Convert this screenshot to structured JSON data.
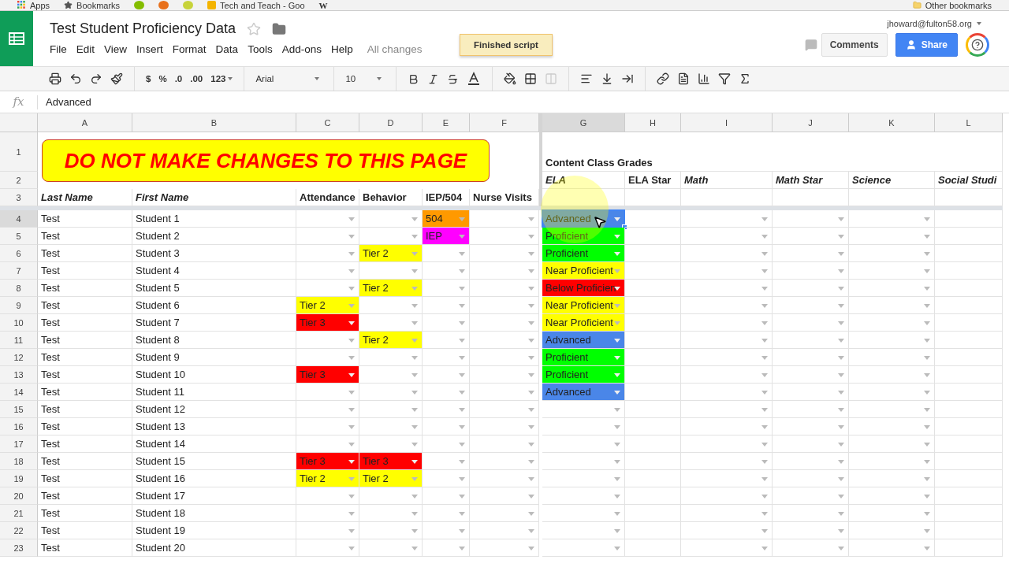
{
  "bookmarks_bar": {
    "items": [
      {
        "kind": "apps",
        "label": "Apps"
      },
      {
        "kind": "star",
        "label": "Bookmarks"
      },
      {
        "kind": "round",
        "color": "#84bd00"
      },
      {
        "kind": "round",
        "color": "#e8711c"
      },
      {
        "kind": "round",
        "color": "#c7d33a"
      },
      {
        "kind": "page",
        "label": "Tech and Teach - Goo"
      },
      {
        "kind": "text_icon",
        "label": "W"
      }
    ],
    "other": "Other bookmarks"
  },
  "document": {
    "title": "Test Student Proficiency Data",
    "starred": false,
    "menu": [
      "File",
      "Edit",
      "View",
      "Insert",
      "Format",
      "Data",
      "Tools",
      "Add-ons",
      "Help"
    ],
    "save_status": "All changes",
    "account": "jhoward@fulton58.org",
    "comments_button": "Comments",
    "share_button": "Share"
  },
  "toast": "Finished script",
  "toolbar": {
    "currency": "$",
    "percent": "%",
    "decimals_less": ".0",
    "decimals_more": ".00",
    "number_formats": "123",
    "font": "Arial",
    "font_size": "10"
  },
  "formula_bar": {
    "label": "fx",
    "value": "Advanced"
  },
  "banner": "DO NOT MAKE CHANGES TO THIS PAGE",
  "columns": [
    {
      "letter": "A",
      "dropdown": false,
      "selected": false
    },
    {
      "letter": "B",
      "dropdown": false,
      "selected": false
    },
    {
      "letter": "C",
      "dropdown": true,
      "selected": false
    },
    {
      "letter": "D",
      "dropdown": true,
      "selected": false
    },
    {
      "letter": "E",
      "dropdown": true,
      "selected": false
    },
    {
      "letter": "F",
      "dropdown": true,
      "selected": false
    },
    {
      "letter": "G",
      "dropdown": true,
      "selected": true
    },
    {
      "letter": "H",
      "dropdown": false,
      "selected": false
    },
    {
      "letter": "I",
      "dropdown": true,
      "selected": false
    },
    {
      "letter": "J",
      "dropdown": true,
      "selected": false
    },
    {
      "letter": "K",
      "dropdown": true,
      "selected": false
    },
    {
      "letter": "L",
      "dropdown": false,
      "selected": false
    }
  ],
  "header_rows": [
    {
      "number": "1",
      "cells": [
        null,
        null,
        null,
        null,
        null,
        null,
        {
          "text": "Content Class Grades",
          "italic": false
        },
        null,
        null,
        null,
        null,
        null
      ]
    },
    {
      "number": "2",
      "cells": [
        null,
        null,
        null,
        null,
        null,
        null,
        {
          "text": "ELA",
          "italic": true
        },
        {
          "text": "ELA Star",
          "italic": false
        },
        {
          "text": "Math",
          "italic": true
        },
        {
          "text": "Math Star",
          "italic": true
        },
        {
          "text": "Science",
          "italic": true
        },
        {
          "text": "Social Studi",
          "italic": true
        }
      ]
    },
    {
      "number": "3",
      "cells": [
        {
          "text": "Last Name",
          "italic": true
        },
        {
          "text": "First Name",
          "italic": true
        },
        {
          "text": "Attendance",
          "italic": false
        },
        {
          "text": "Behavior",
          "italic": false
        },
        {
          "text": "IEP/504",
          "italic": false
        },
        {
          "text": "Nurse Visits",
          "italic": false
        },
        null,
        null,
        null,
        null,
        null,
        null
      ]
    }
  ],
  "rows": [
    {
      "number": "4",
      "selected": true,
      "last_name": "Test",
      "first_name": "Student 1",
      "cells": [
        null,
        null,
        {
          "text": "504",
          "color": "#ff9900"
        },
        null,
        {
          "text": "Advanced",
          "color": "#4a86e8"
        },
        null,
        null,
        null,
        null,
        null
      ]
    },
    {
      "number": "5",
      "selected": false,
      "last_name": "Test",
      "first_name": "Student 2",
      "cells": [
        null,
        null,
        {
          "text": "IEP",
          "color": "#ff00ff"
        },
        null,
        {
          "text": "Proficient",
          "color": "#00ff00"
        },
        null,
        null,
        null,
        null,
        null
      ]
    },
    {
      "number": "6",
      "selected": false,
      "last_name": "Test",
      "first_name": "Student 3",
      "cells": [
        null,
        {
          "text": "Tier 2",
          "color": "#ffff00"
        },
        null,
        null,
        {
          "text": "Proficient",
          "color": "#00ff00"
        },
        null,
        null,
        null,
        null,
        null
      ]
    },
    {
      "number": "7",
      "selected": false,
      "last_name": "Test",
      "first_name": "Student 4",
      "cells": [
        null,
        null,
        null,
        null,
        {
          "text": "Near Proficient",
          "color": "#ffff00"
        },
        null,
        null,
        null,
        null,
        null
      ]
    },
    {
      "number": "8",
      "selected": false,
      "last_name": "Test",
      "first_name": "Student 5",
      "cells": [
        null,
        {
          "text": "Tier 2",
          "color": "#ffff00"
        },
        null,
        null,
        {
          "text": "Below Proficien",
          "color": "#ff0000"
        },
        null,
        null,
        null,
        null,
        null
      ]
    },
    {
      "number": "9",
      "selected": false,
      "last_name": "Test",
      "first_name": "Student 6",
      "cells": [
        {
          "text": "Tier 2",
          "color": "#ffff00"
        },
        null,
        null,
        null,
        {
          "text": "Near Proficient",
          "color": "#ffff00"
        },
        null,
        null,
        null,
        null,
        null
      ]
    },
    {
      "number": "10",
      "selected": false,
      "last_name": "Test",
      "first_name": "Student 7",
      "cells": [
        {
          "text": "Tier 3",
          "color": "#ff0000"
        },
        null,
        null,
        null,
        {
          "text": "Near Proficient",
          "color": "#ffff00"
        },
        null,
        null,
        null,
        null,
        null
      ]
    },
    {
      "number": "11",
      "selected": false,
      "last_name": "Test",
      "first_name": "Student 8",
      "cells": [
        null,
        {
          "text": "Tier 2",
          "color": "#ffff00"
        },
        null,
        null,
        {
          "text": "Advanced",
          "color": "#4a86e8"
        },
        null,
        null,
        null,
        null,
        null
      ]
    },
    {
      "number": "12",
      "selected": false,
      "last_name": "Test",
      "first_name": "Student 9",
      "cells": [
        null,
        null,
        null,
        null,
        {
          "text": "Proficient",
          "color": "#00ff00"
        },
        null,
        null,
        null,
        null,
        null
      ]
    },
    {
      "number": "13",
      "selected": false,
      "last_name": "Test",
      "first_name": "Student 10",
      "cells": [
        {
          "text": "Tier 3",
          "color": "#ff0000"
        },
        null,
        null,
        null,
        {
          "text": "Proficient",
          "color": "#00ff00"
        },
        null,
        null,
        null,
        null,
        null
      ]
    },
    {
      "number": "14",
      "selected": false,
      "last_name": "Test",
      "first_name": "Student 11",
      "cells": [
        null,
        null,
        null,
        null,
        {
          "text": "Advanced",
          "color": "#4a86e8"
        },
        null,
        null,
        null,
        null,
        null
      ]
    },
    {
      "number": "15",
      "selected": false,
      "last_name": "Test",
      "first_name": "Student 12",
      "cells": [
        null,
        null,
        null,
        null,
        null,
        null,
        null,
        null,
        null,
        null
      ]
    },
    {
      "number": "16",
      "selected": false,
      "last_name": "Test",
      "first_name": "Student 13",
      "cells": [
        null,
        null,
        null,
        null,
        null,
        null,
        null,
        null,
        null,
        null
      ]
    },
    {
      "number": "17",
      "selected": false,
      "last_name": "Test",
      "first_name": "Student 14",
      "cells": [
        null,
        null,
        null,
        null,
        null,
        null,
        null,
        null,
        null,
        null
      ]
    },
    {
      "number": "18",
      "selected": false,
      "last_name": "Test",
      "first_name": "Student 15",
      "cells": [
        {
          "text": "Tier 3",
          "color": "#ff0000"
        },
        {
          "text": "Tier 3",
          "color": "#ff0000"
        },
        null,
        null,
        null,
        null,
        null,
        null,
        null,
        null
      ]
    },
    {
      "number": "19",
      "selected": false,
      "last_name": "Test",
      "first_name": "Student 16",
      "cells": [
        {
          "text": "Tier 2",
          "color": "#ffff00"
        },
        {
          "text": "Tier 2",
          "color": "#ffff00"
        },
        null,
        null,
        null,
        null,
        null,
        null,
        null,
        null
      ]
    },
    {
      "number": "20",
      "selected": false,
      "last_name": "Test",
      "first_name": "Student 17",
      "cells": [
        null,
        null,
        null,
        null,
        null,
        null,
        null,
        null,
        null,
        null
      ]
    },
    {
      "number": "21",
      "selected": false,
      "last_name": "Test",
      "first_name": "Student 18",
      "cells": [
        null,
        null,
        null,
        null,
        null,
        null,
        null,
        null,
        null,
        null
      ]
    },
    {
      "number": "22",
      "selected": false,
      "last_name": "Test",
      "first_name": "Student 19",
      "cells": [
        null,
        null,
        null,
        null,
        null,
        null,
        null,
        null,
        null,
        null
      ]
    },
    {
      "number": "23",
      "selected": false,
      "last_name": "Test",
      "first_name": "Student 20",
      "cells": [
        null,
        null,
        null,
        null,
        null,
        null,
        null,
        null,
        null,
        null
      ]
    }
  ]
}
